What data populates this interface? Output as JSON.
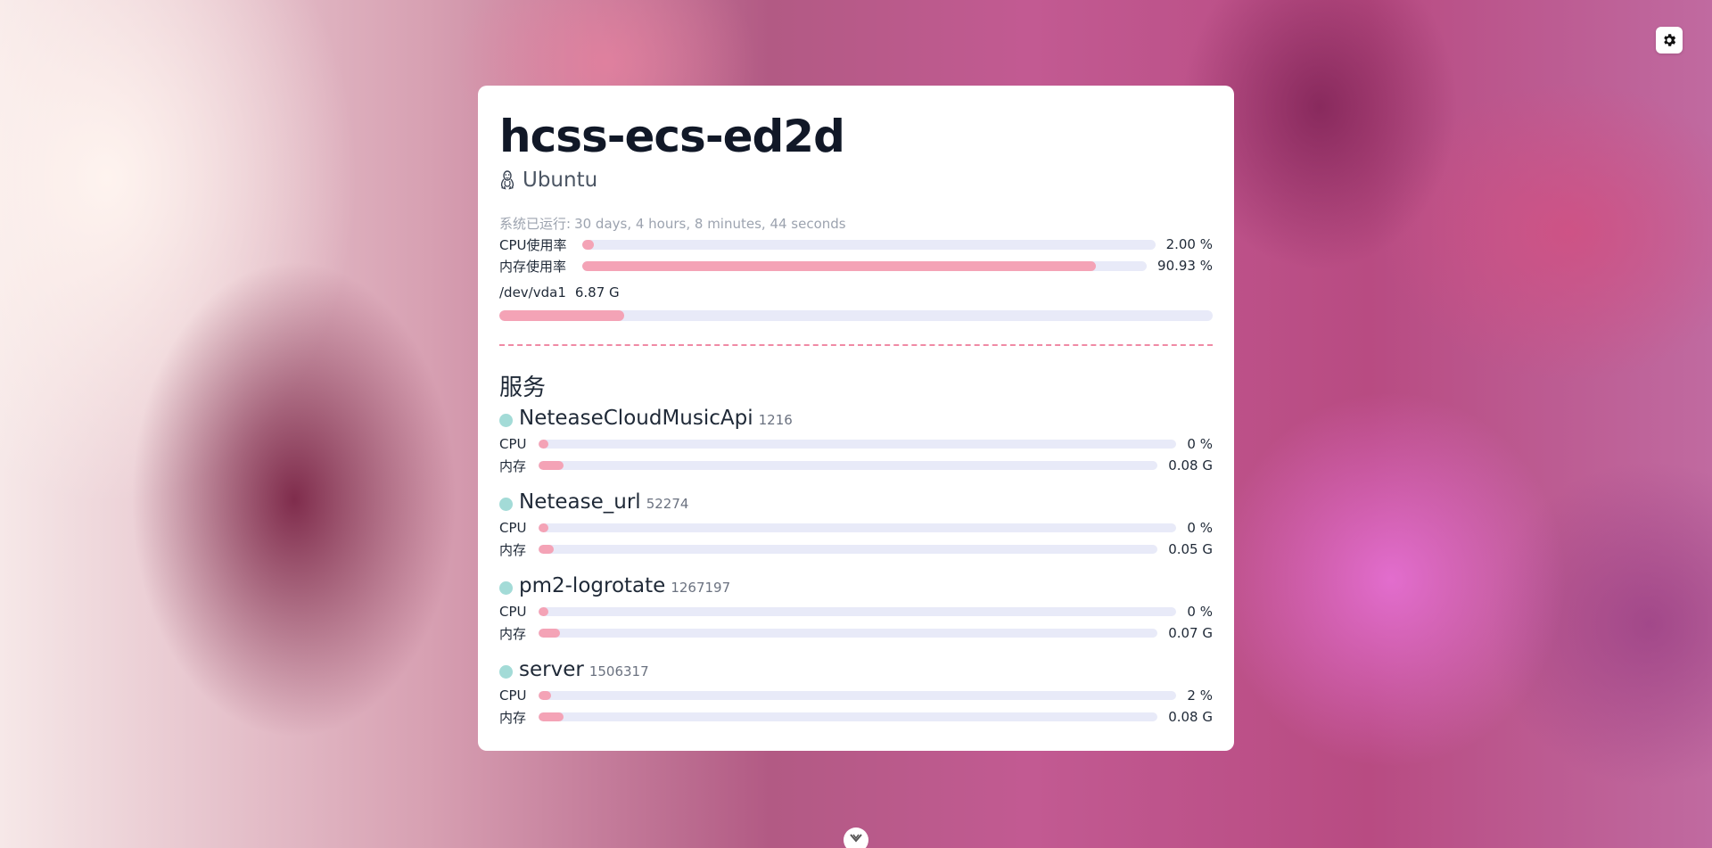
{
  "colors": {
    "accent": "#f4a3b6",
    "track": "#e8eaf8",
    "status_online": "#a3dbd7",
    "divider": "#f08aa5"
  },
  "icons": {
    "settings": "gear-icon",
    "os": "linux-icon",
    "scroll": "chevron-down-icon"
  },
  "host": {
    "name": "hcss-ecs-ed2d",
    "os": "Ubuntu"
  },
  "system": {
    "uptime_label": "系统已运行:",
    "uptime_value": "30 days, 4 hours, 8 minutes, 44 seconds",
    "cpu": {
      "label": "CPU使用率",
      "value_text": "2.00 %",
      "percent": 2
    },
    "memory": {
      "label": "内存使用率",
      "value_text": "90.93 %",
      "percent": 90.93
    },
    "disk": {
      "device": "/dev/vda1",
      "size": "6.87 G",
      "percent": 17.5
    }
  },
  "services_title": "服务",
  "services": [
    {
      "name": "NeteaseCloudMusicApi",
      "pid": "1216",
      "cpu_label": "CPU",
      "cpu_text": "0 %",
      "cpu_percent": 0,
      "mem_label": "内存",
      "mem_text": "0.08 G",
      "mem_percent": 4
    },
    {
      "name": "Netease_url",
      "pid": "52274",
      "cpu_label": "CPU",
      "cpu_text": "0 %",
      "cpu_percent": 0,
      "mem_label": "内存",
      "mem_text": "0.05 G",
      "mem_percent": 2.5
    },
    {
      "name": "pm2-logrotate",
      "pid": "1267197",
      "cpu_label": "CPU",
      "cpu_text": "0 %",
      "cpu_percent": 0,
      "mem_label": "内存",
      "mem_text": "0.07 G",
      "mem_percent": 3.5
    },
    {
      "name": "server",
      "pid": "1506317",
      "cpu_label": "CPU",
      "cpu_text": "2 %",
      "cpu_percent": 2,
      "mem_label": "内存",
      "mem_text": "0.08 G",
      "mem_percent": 4
    }
  ]
}
